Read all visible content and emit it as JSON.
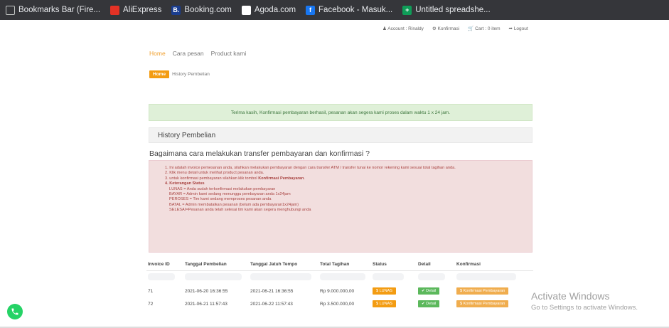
{
  "bookmarks": [
    {
      "label": "Bookmarks Bar (Fire...",
      "icon": "folder-icon"
    },
    {
      "label": "AliExpress",
      "icon": "aliexpress-icon"
    },
    {
      "label": "Booking.com",
      "icon": "booking-icon"
    },
    {
      "label": "Agoda.com",
      "icon": "agoda-icon"
    },
    {
      "label": "Facebook - Masuk...",
      "icon": "facebook-icon"
    },
    {
      "label": "Untitled spreadshe...",
      "icon": "spreadsheet-icon"
    }
  ],
  "bm_glyphs": {
    "booking": "B.",
    "agoda": "a",
    "facebook": "f",
    "sheet": "+"
  },
  "topnav": {
    "account": "Account : Rinaldy",
    "konfirmasi": "Konfirmasi",
    "cart": "Cart : 0 item",
    "logout": "Logout"
  },
  "menu": {
    "home": "Home",
    "cara": "Cara pesan",
    "product": "Product kami"
  },
  "breadcrumb": {
    "home": "Home",
    "current": "History Pembelian"
  },
  "success_alert": "Terima kasih, Konfirmasi pembayaran berhasil, pesanan akan segera kami proses dalam waktu 1 x 24 jam.",
  "history_title": "History Pembelian",
  "how_title": "Bagaimana cara melakukan transfer pembayaran dan konfirmasi ?",
  "info": {
    "l1": "1. Ini adalah invoice pemesanan anda, silahkan melakukan pembayaran dengan cara transfer ATM / transfer tunai ke nomor rekening kami sesuai total tagihan anda.",
    "l2": "2. Klik menu detail untuk melihat product pesanan anda.",
    "l3a": "3. untuk konfirmasi pembayaran silahkan klik tombol ",
    "l3b": "Konfirmasi Pembayaran",
    "l3c": ".",
    "l4": "4. Keterangan Status",
    "s1": "LUNAS = Anda sudah terkonfirmasi melakukan pembayaran",
    "s2": "BAYAR = Admin kami sedang menunggu pembayaran anda 1x24jam",
    "s3": "PEROSES = Tim kami sedang memproses pesanan anda",
    "s4": "BATAL = Admin membatalkan pesanan (belum ada pembayaran1x24jam)",
    "s5": "SELESAI=Pesanan anda telah selesai tim kami akan segera menghubungi anda"
  },
  "table": {
    "headers": [
      "Invoice ID",
      "Tanggal Pembelian",
      "Tanggal Jatuh Tempo",
      "Total Tagihan",
      "Status",
      "Detail",
      "Konfirmasi"
    ],
    "rows": [
      {
        "id": "71",
        "tgl": "2021-06-20 16:36:55",
        "jatuh": "2021-06-21 16:36:55",
        "total": "Rp 9.000.000,00",
        "status": "$ LUNAS",
        "detail": "✔ Detail",
        "konf": "$ Konfirmasi Pembayaran"
      },
      {
        "id": "72",
        "tgl": "2021-06-21 11:57:43",
        "jatuh": "2021-06-22 11:57:43",
        "total": "Rp 3.500.000,00",
        "status": "$ LUNAS",
        "detail": "✔ Detail",
        "konf": "$ Konfirmasi Pembayaran"
      }
    ]
  },
  "activate": {
    "title": "Activate Windows",
    "sub": "Go to Settings to activate Windows."
  },
  "colors": {
    "accent": "#f39c12",
    "success": "#5cb85c",
    "whatsapp": "#25d366"
  }
}
